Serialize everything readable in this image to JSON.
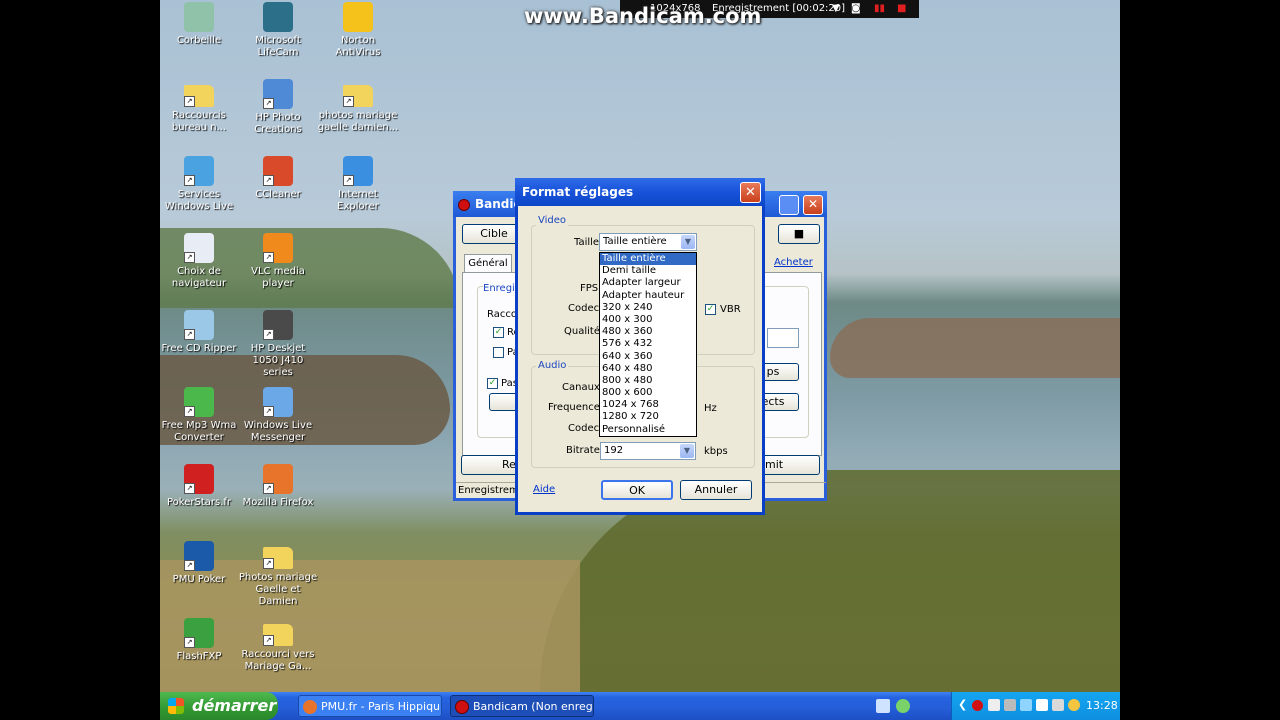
{
  "watermark": {
    "text": "www.Bandicam.com",
    "resolution": "1024x768",
    "status": "Enregistrement [00:02:20]"
  },
  "desktop_icons": [
    {
      "label": "Corbeille",
      "icon": "recycle-bin-icon"
    },
    {
      "label": "Microsoft LifeCam",
      "icon": "webcam-icon"
    },
    {
      "label": "Norton AntiVirus",
      "icon": "norton-icon"
    },
    {
      "label": "Raccourcis bureau n...",
      "icon": "folder-icon"
    },
    {
      "label": "HP Photo Creations",
      "icon": "photo-icon"
    },
    {
      "label": "photos mariage gaelle damien...",
      "icon": "folder-icon"
    },
    {
      "label": "Services Windows Live",
      "icon": "windows-live-icon"
    },
    {
      "label": "CCleaner",
      "icon": "ccleaner-icon"
    },
    {
      "label": "Internet Explorer",
      "icon": "internet-explorer-icon"
    },
    {
      "label": "Choix de navigateur",
      "icon": "browser-choice-icon"
    },
    {
      "label": "VLC media player",
      "icon": "vlc-icon"
    },
    {
      "label": "Free CD Ripper",
      "icon": "cd-icon"
    },
    {
      "label": "HP Deskjet 1050 J410 series",
      "icon": "printer-icon"
    },
    {
      "label": "Free Mp3 Wma Converter",
      "icon": "converter-icon"
    },
    {
      "label": "Windows Live Messenger",
      "icon": "messenger-icon"
    },
    {
      "label": "PokerStars.fr",
      "icon": "pokerstars-icon"
    },
    {
      "label": "Mozilla Firefox",
      "icon": "firefox-icon"
    },
    {
      "label": "PMU Poker",
      "icon": "pmu-icon"
    },
    {
      "label": "Photos mariage Gaelle et Damien",
      "icon": "folder-icon"
    },
    {
      "label": "FlashFXP",
      "icon": "flashfxp-icon"
    },
    {
      "label": "Raccourci vers Mariage Ga...",
      "icon": "folder-icon"
    }
  ],
  "bandicam": {
    "title": "Bandic",
    "cible": "Cible",
    "tab_general": "Général",
    "acheter": "Acheter",
    "group": "Enregis",
    "raccou": "Raccou",
    "check1": "Re",
    "check2": "Pa",
    "check3": "Pas",
    "btn_ps": "ps",
    "btn_ects": "ects",
    "btn_re": "Re",
    "btn_mit": "mit",
    "status": "Enregistreme"
  },
  "dialog": {
    "title": "Format réglages",
    "video_group": "Video",
    "taille_label": "Taille",
    "taille_value": "Taille entière",
    "fps_label": "FPS",
    "codec_label": "Codec",
    "vbr_label": "VBR",
    "qualite_label": "Qualité",
    "audio_group": "Audio",
    "canaux_label": "Canaux",
    "frequence_label": "Frequence",
    "hz_label": "Hz",
    "audio_codec_label": "Codec",
    "bitrate_label": "Bitrate",
    "bitrate_value": "192",
    "kbps_label": "kbps",
    "help_link": "Aide",
    "ok": "OK",
    "cancel": "Annuler",
    "size_options": [
      "Taille entière",
      "Demi taille",
      "Adapter largeur",
      "Adapter hauteur",
      "320 x 240",
      "400 x 300",
      "480 x 360",
      "576 x 432",
      "640 x 360",
      "640 x 480",
      "800 x 480",
      "800 x 600",
      "1024 x 768",
      "1280 x 720",
      "Personnalisé"
    ]
  },
  "taskbar": {
    "start": "démarrer",
    "tasks": [
      "PMU.fr - Paris Hippiqu...",
      "Bandicam (Non enregi..."
    ],
    "clock": "13:28"
  }
}
